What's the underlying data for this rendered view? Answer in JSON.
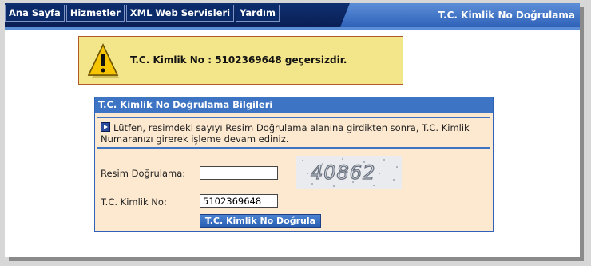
{
  "nav": {
    "items": [
      "Ana Sayfa",
      "Hizmetler",
      "XML Web Servisleri",
      "Yardım"
    ]
  },
  "header": {
    "title": "T.C. Kimlik No Doğrulama"
  },
  "alert": {
    "message": "T.C. Kimlik No : 5102369648 geçersizdir."
  },
  "panel": {
    "title": "T.C. Kimlik No Doğrulama Bilgileri",
    "info": "Lütfen, resimdeki sayıyı Resim Doğrulama alanına girdikten sonra, T.C. Kimlik Numaranızı girerek işleme devam ediniz.",
    "captcha_label": "Resim Doğrulama:",
    "captcha_value": "",
    "captcha_text": "40862",
    "id_label": "T.C. Kimlik No:",
    "id_value": "5102369648",
    "submit_label": "T.C. Kimlik No Doğrula"
  },
  "colors": {
    "navy": "#0a1f55",
    "accent_blue": "#3d74c3",
    "alert_bg": "#f3e58a",
    "panel_bg": "#fde9d0"
  },
  "icons": [
    "warning-icon",
    "arrow-right-icon"
  ]
}
